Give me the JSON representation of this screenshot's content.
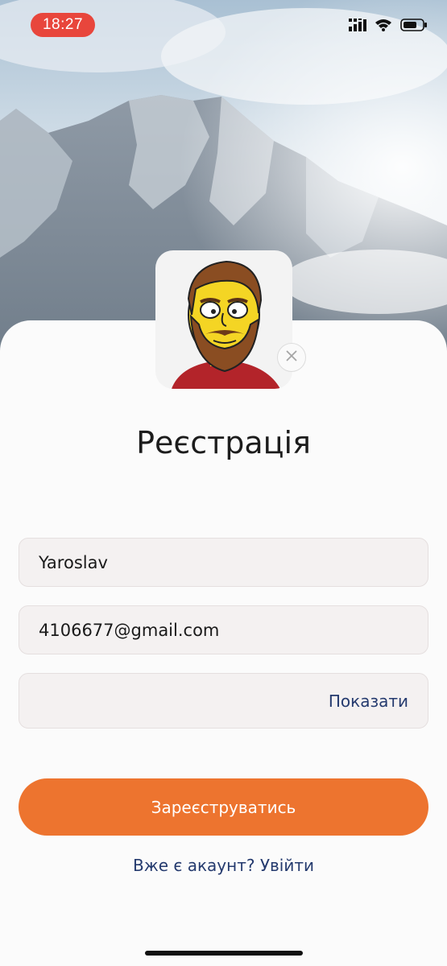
{
  "status_bar": {
    "time": "18:27",
    "icons": [
      "signal-icon",
      "wifi-icon",
      "battery-icon"
    ],
    "time_pill_color": "#e8463c"
  },
  "header": {
    "title": "Реєстрація"
  },
  "avatar": {
    "description_icon": "cartoon-avatar",
    "remove_icon": "close-icon"
  },
  "form": {
    "name": {
      "value": "Yaroslav",
      "placeholder": ""
    },
    "email": {
      "value": "4106677@gmail.com",
      "placeholder": ""
    },
    "password": {
      "value": "",
      "placeholder": "",
      "toggle_label": "Показати"
    }
  },
  "actions": {
    "register_label": "Зареєструватись",
    "login_prompt": "Вже є акаунт? Увійти"
  },
  "colors": {
    "accent": "#ed742f",
    "link": "#243a6e",
    "field_bg": "#f4f1f1"
  }
}
